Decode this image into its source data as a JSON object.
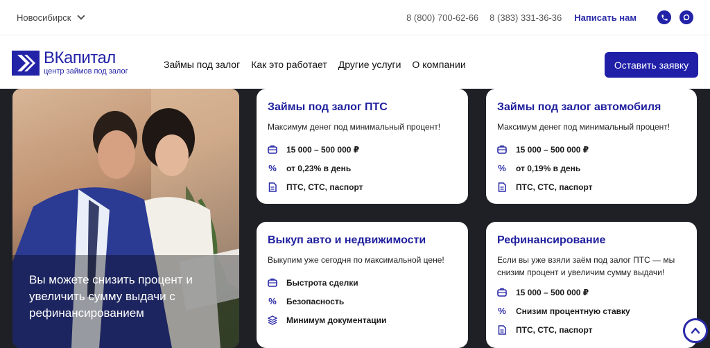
{
  "topbar": {
    "city": "Новосибирск",
    "phone1": "8 (800) 700-62-66",
    "phone2": "8 (383) 331-36-36",
    "write_label": "Написать нам"
  },
  "logo": {
    "name": "ВКапитал",
    "subtitle": "центр займов под залог"
  },
  "nav": {
    "items": [
      "Займы под залог",
      "Как это работает",
      "Другие услуги",
      "О компании"
    ],
    "cta": "Оставить заявку"
  },
  "promo": {
    "text": "Вы можете снизить процент и увеличить сумму выдачи с рефинансированием"
  },
  "cards": [
    {
      "title": "Займы под залог ПТС",
      "desc": "Максимум денег под минимальный процент!",
      "features": [
        {
          "icon": "briefcase-icon",
          "text": "15 000 – 500 000 ₽"
        },
        {
          "icon": "percent-icon",
          "text": "от 0,23% в день"
        },
        {
          "icon": "document-icon",
          "text": "ПТС, СТС, паспорт"
        }
      ]
    },
    {
      "title": "Займы под залог автомобиля",
      "desc": "Максимум денег под минимальный процент!",
      "features": [
        {
          "icon": "briefcase-icon",
          "text": "15 000 – 500 000 ₽"
        },
        {
          "icon": "percent-icon",
          "text": "от 0,19% в день"
        },
        {
          "icon": "document-icon",
          "text": "ПТС, СТС, паспорт"
        }
      ]
    },
    {
      "title": "Выкуп авто и недвижимости",
      "desc": "Выкупим уже сегодня по максимальной цене!",
      "features": [
        {
          "icon": "briefcase-icon",
          "text": "Быстрота сделки"
        },
        {
          "icon": "percent-icon",
          "text": "Безопасность"
        },
        {
          "icon": "layers-icon",
          "text": "Минимум документации"
        }
      ]
    },
    {
      "title": "Рефинансирование",
      "desc": "Если вы уже взяли заём под залог ПТС — мы снизим процент и увеличим сумму выдачи!",
      "features": [
        {
          "icon": "briefcase-icon",
          "text": "15 000 – 500 000 ₽"
        },
        {
          "icon": "percent-icon",
          "text": "Снизим процентную ставку"
        },
        {
          "icon": "document-icon",
          "text": "ПТС, СТС, паспорт"
        }
      ]
    }
  ],
  "colors": {
    "brand": "#1f1fa8",
    "dark_bg": "#1e2026"
  }
}
